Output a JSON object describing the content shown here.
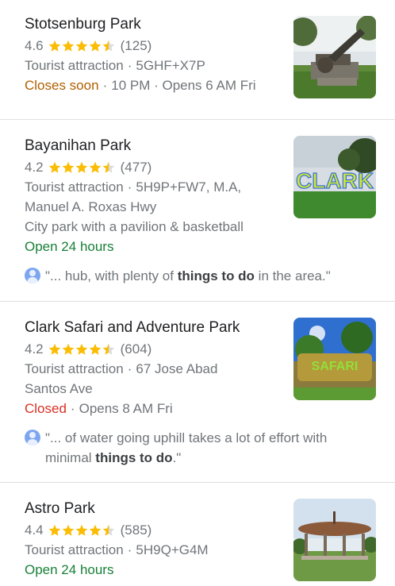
{
  "places": [
    {
      "name": "Stotsenburg Park",
      "rating": "4.6",
      "rating_value": 4.6,
      "reviews": "(125)",
      "category": "Tourist attraction",
      "address_lines": [
        "5GHF+X7P"
      ],
      "status": "Closes soon",
      "status_color": "#b06000",
      "hours": "10 PM · Opens 6 AM Fri",
      "photo_icon": "cannon-monument-photo"
    },
    {
      "name": "Bayanihan Park",
      "rating": "4.2",
      "rating_value": 4.2,
      "reviews": "(477)",
      "category": "Tourist attraction",
      "address_lines": [
        "5H9P+FW7, M.A,",
        "Manuel A. Roxas Hwy"
      ],
      "description": "City park with a pavilion & basketball",
      "status": "Open 24 hours",
      "status_color": "#188038",
      "review_prefix": "\"... hub, with plenty of ",
      "review_bold": "things to do",
      "review_suffix": " in the area.\"",
      "photo_text": "CLARK",
      "photo_icon": "clark-sign-photo"
    },
    {
      "name": "Clark Safari and Adventure Park",
      "rating": "4.2",
      "rating_value": 4.2,
      "reviews": "(604)",
      "category": "Tourist attraction",
      "address_lines": [
        "67 Jose Abad",
        "Santos Ave"
      ],
      "status": "Closed",
      "status_color": "#d93025",
      "hours": "Opens 8 AM Fri",
      "review_prefix": "\"... of water going uphill takes a lot of effort with minimal ",
      "review_bold": "things to do",
      "review_suffix": ".\"",
      "photo_text": "SAFARI",
      "photo_icon": "safari-entrance-photo"
    },
    {
      "name": "Astro Park",
      "rating": "4.4",
      "rating_value": 4.4,
      "reviews": "(585)",
      "category": "Tourist attraction",
      "address_lines": [
        "5H9Q+G4M"
      ],
      "status": "Open 24 hours",
      "status_color": "#188038",
      "photo_icon": "gazebo-photo"
    }
  ],
  "separator": "·",
  "colors": {
    "star": "#fbbc04",
    "star_empty": "#dadce0",
    "text": "#202124",
    "muted": "#70757a"
  }
}
